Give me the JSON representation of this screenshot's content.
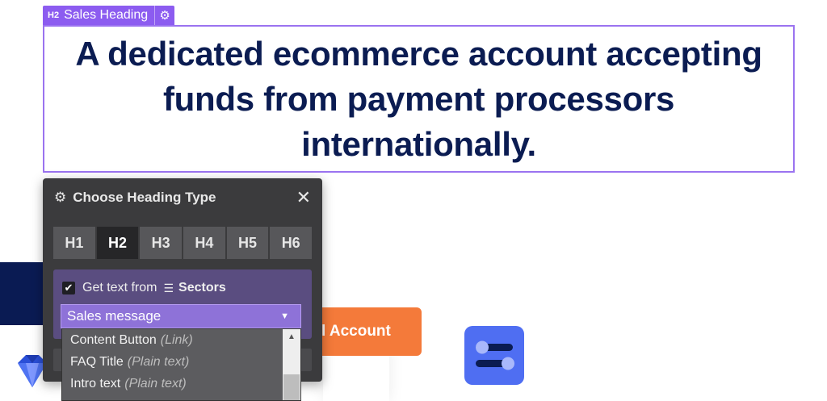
{
  "canvas": {
    "cta_button_label": "l Account"
  },
  "selection": {
    "tag_level": "H2",
    "tag_name": "Sales Heading",
    "gear_glyph": "⚙"
  },
  "heading": {
    "text": "A dedicated ecommerce account accepting funds from payment processors internationally."
  },
  "panel": {
    "title": "Choose Heading Type",
    "gear_glyph": "⚙",
    "close_glyph": "✕",
    "tabs": [
      {
        "label": "H1",
        "active": false
      },
      {
        "label": "H2",
        "active": true
      },
      {
        "label": "H3",
        "active": false
      },
      {
        "label": "H4",
        "active": false
      },
      {
        "label": "H5",
        "active": false
      },
      {
        "label": "H6",
        "active": false
      }
    ],
    "source": {
      "checked": true,
      "check_glyph": "✔",
      "label": "Get text from",
      "db_glyph": "☰",
      "collection": "Sectors",
      "selected_field": "Sales message",
      "caret_glyph": "▼"
    }
  },
  "dropdown": {
    "options": [
      {
        "name": "Content Button",
        "kind": "(Link)"
      },
      {
        "name": "FAQ Title",
        "kind": "(Plain text)"
      },
      {
        "name": "Intro text",
        "kind": "(Plain text)"
      }
    ],
    "scroll_up_glyph": "▲"
  },
  "colors": {
    "heading_text": "#0b1c52",
    "selection_accent": "#8c5cf0",
    "panel_bg": "#3b3b3d",
    "cta_orange": "#f47a3a",
    "tile_blue": "#4f6ef2"
  }
}
